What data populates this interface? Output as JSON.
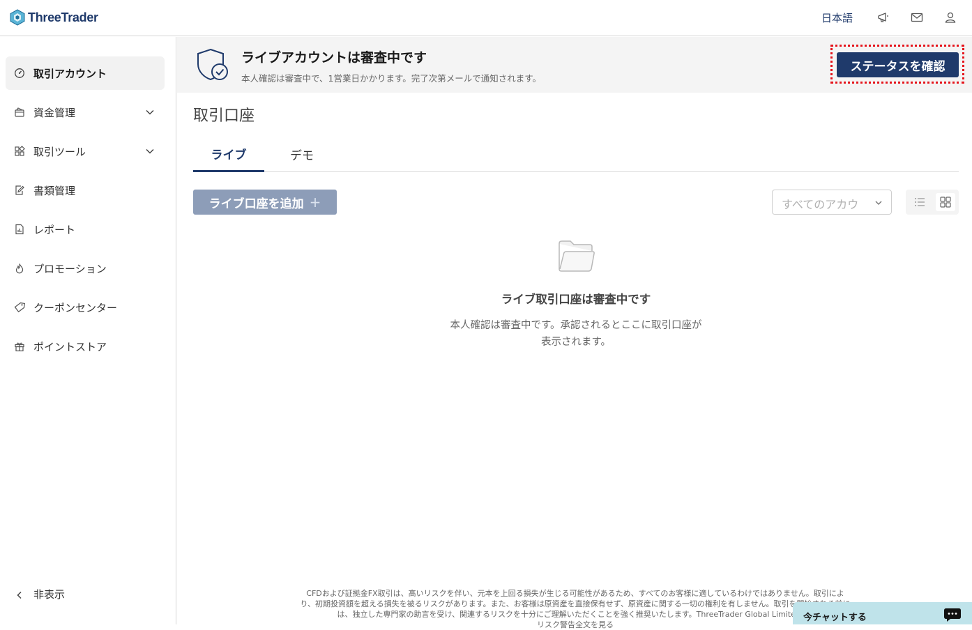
{
  "header": {
    "brand": "ThreeTrader",
    "language": "日本語"
  },
  "sidebar": {
    "items": [
      {
        "label": "取引アカウント",
        "icon": "gauge-icon",
        "active": true
      },
      {
        "label": "資金管理",
        "icon": "wallet-icon",
        "expandable": true
      },
      {
        "label": "取引ツール",
        "icon": "apps-icon",
        "expandable": true
      },
      {
        "label": "書類管理",
        "icon": "document-edit-icon"
      },
      {
        "label": "レポート",
        "icon": "report-icon"
      },
      {
        "label": "プロモーション",
        "icon": "flame-icon"
      },
      {
        "label": "クーポンセンター",
        "icon": "tag-icon"
      },
      {
        "label": "ポイントストア",
        "icon": "gift-icon"
      }
    ],
    "hide_label": "非表示"
  },
  "banner": {
    "title": "ライブアカウントは審査中です",
    "subtitle": "本人確認は審査中で、1営業日かかります。完了次第メールで通知されます。",
    "button": "ステータスを確認"
  },
  "main": {
    "title": "取引口座",
    "tabs": [
      {
        "label": "ライブ",
        "active": true
      },
      {
        "label": "デモ",
        "active": false
      }
    ],
    "add_button": "ライブ口座を追加",
    "add_plus": "+",
    "filter_select": "すべてのアカウ",
    "empty_title": "ライブ取引口座は審査中です",
    "empty_desc_line1": "本人確認は審査中です。承認されるとここに取引口座が",
    "empty_desc_line2": "表示されます。"
  },
  "footer": {
    "line1": "CFDおよび証拠金FX取引は、高いリスクを伴い、元本を上回る損失が生じる可能性があるため、すべてのお客様に適しているわけではありません。取引によ",
    "line2": "り、初期投資額を超える損失を被るリスクがあります。また、お客様は原資産を直接保有せず、原資産に関する一切の権利を有しません。取引を開始される前に",
    "line3": "は、独立した専門家の助言を受け、関連するリスクを十分にご理解いただくことを強く推奨いたします。ThreeTrader Global Limited、V",
    "line4": "リスク警告全文を見る"
  },
  "chat": {
    "label": "今チャットする"
  },
  "colors": {
    "brand_navy": "#1f3a6b",
    "highlight_red": "#e5141b",
    "disabled_button": "#8d9db8",
    "chat_bg": "#bfe3ea"
  }
}
